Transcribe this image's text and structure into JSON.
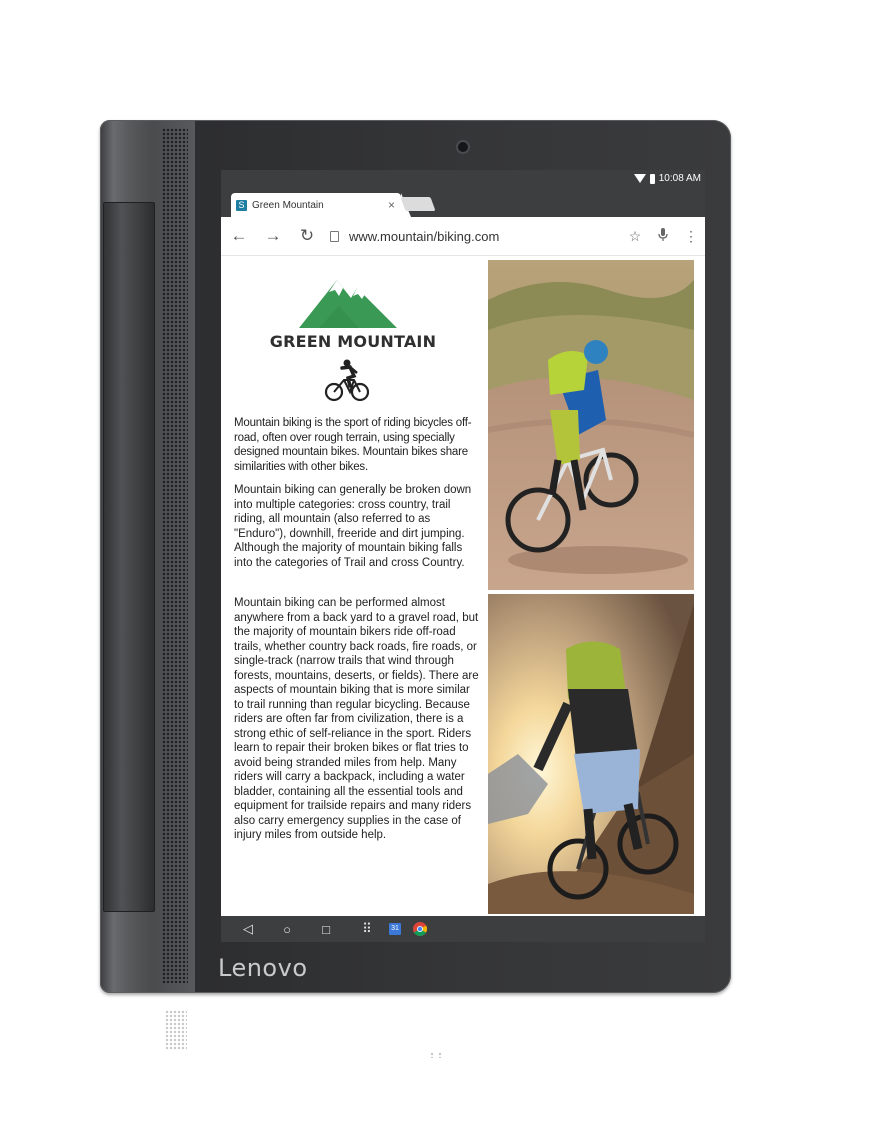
{
  "device": {
    "brand": "Lenovo"
  },
  "statusbar": {
    "time": "10:08 AM"
  },
  "browser": {
    "tab": {
      "favicon": "S",
      "title": "Green Mountain",
      "close": "×"
    },
    "url": "www.mountain/biking.com",
    "icons": [
      "back-arrow-icon",
      "forward-arrow-icon",
      "reload-icon",
      "page-icon",
      "star-icon",
      "mic-icon",
      "more-vert-icon"
    ]
  },
  "page": {
    "site_title": "GREEN MOUNTAIN",
    "logo_color": "#3a9a55",
    "paragraphs": [
      "Mountain biking is the sport of riding bicycles off-road, often over rough terrain, using specially designed mountain bikes. Mountain bikes share similarities with other bikes.",
      "Mountain biking can generally be broken down into multiple categories: cross country, trail riding, all mountain (also referred to as \"Enduro\"), downhill, freeride and dirt jumping. Although the majority of mountain biking falls into the categories of Trail and cross Country.",
      "Mountain biking can be performed almost anywhere from a back yard to a gravel road, but the majority of mountain bikers ride off-road trails, whether country back roads, fire roads, or single-track (narrow trails that wind through forests, mountains, deserts, or fields). There are aspects of mountain biking that is more similar to trail running than regular bicycling. Because riders are often far from civilization, there is a strong ethic of self-reliance in the sport. Riders learn to repair their broken bikes or flat tries to avoid being stranded miles from help. Many riders will carry a backpack, including a water bladder, containing all the essential tools and equipment for trailside repairs and many riders also carry emergency supplies in the case of injury miles from outside help."
    ]
  },
  "navbar": {
    "back": "◁",
    "home": "○",
    "recents": "□",
    "apps": "⠿",
    "calendar": "31"
  }
}
